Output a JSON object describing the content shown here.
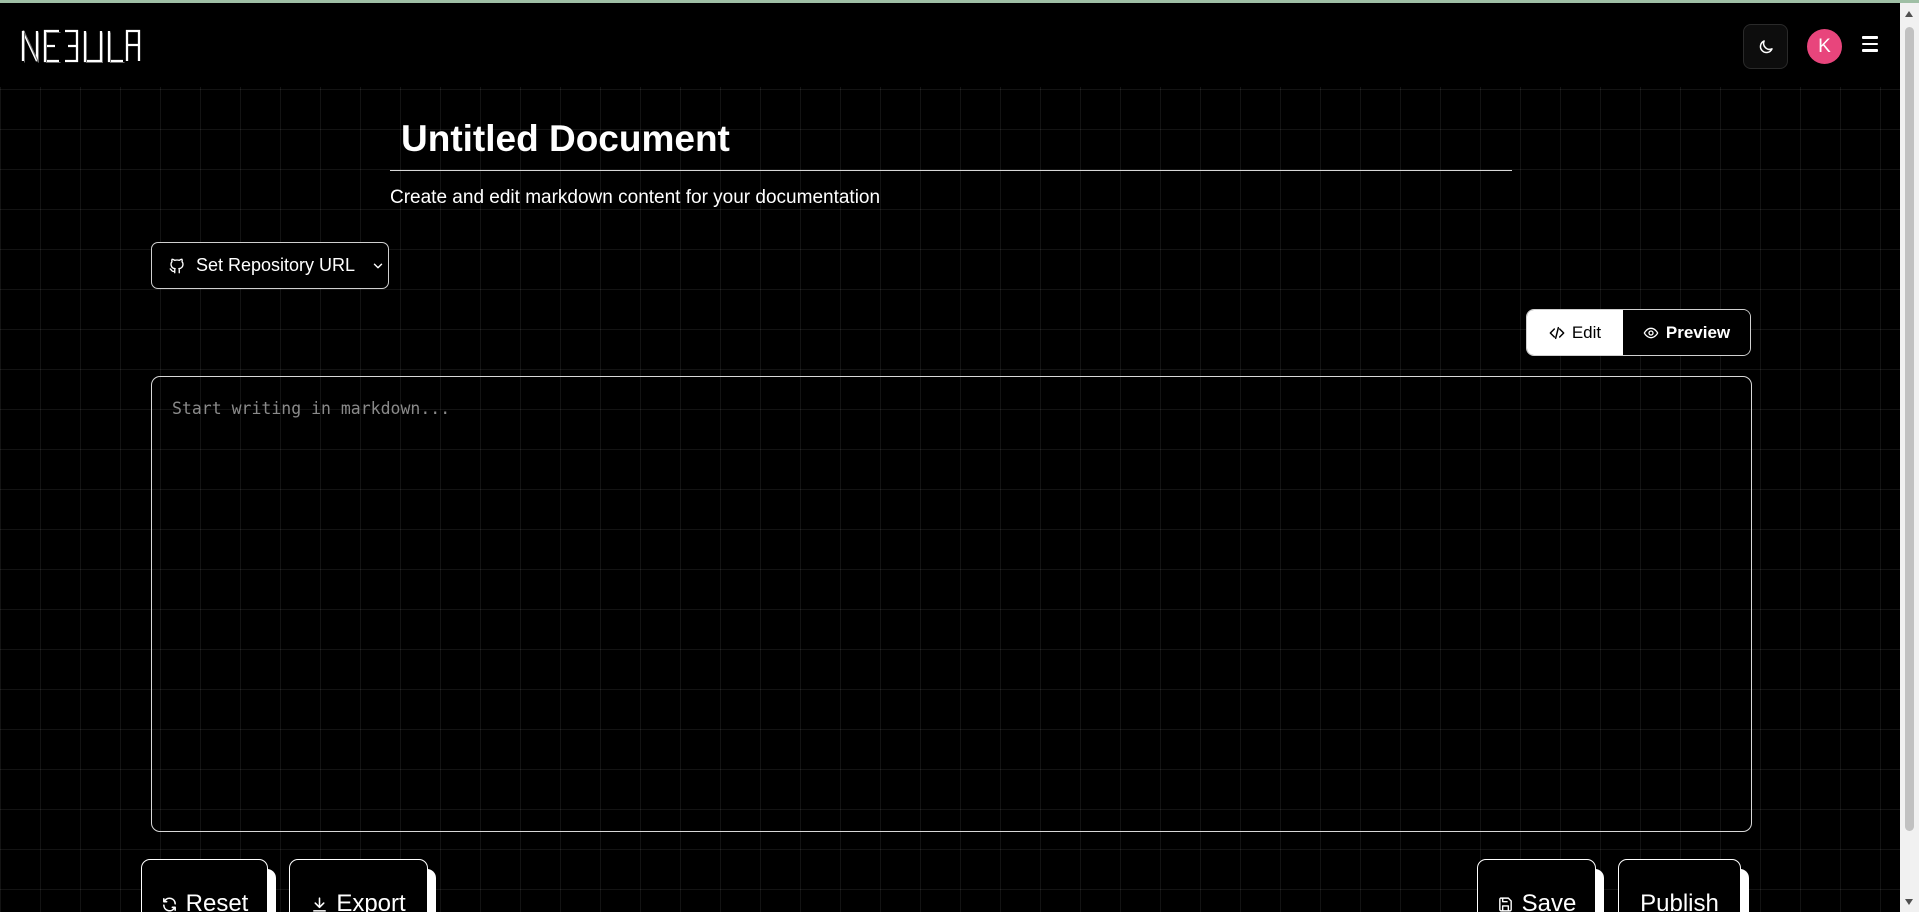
{
  "app": {
    "logo_text": "NEBULA"
  },
  "header": {
    "avatar_initial": "K"
  },
  "document": {
    "title": "Untitled Document",
    "subtitle": "Create and edit markdown content for your documentation"
  },
  "repo": {
    "button_label": "Set Repository URL"
  },
  "mode_toggle": {
    "edit_label": "Edit",
    "preview_label": "Preview",
    "active": "Edit"
  },
  "editor": {
    "value": "",
    "placeholder": "Start writing in markdown..."
  },
  "actions": {
    "reset_label": "Reset",
    "export_label": "Export",
    "save_label": "Save",
    "publish_label": "Publish"
  },
  "icons": {
    "theme": "moon-icon",
    "menu": "hamburger-menu-icon",
    "repo": "github-icon",
    "repo_chevron": "chevron-down-icon",
    "edit": "code-icon",
    "preview": "eye-icon",
    "reset": "refresh-icon",
    "export": "download-icon",
    "save": "save-icon"
  },
  "colors": {
    "avatar_bg": "#e8457c",
    "background": "#000000",
    "accent": "#ffffff"
  }
}
